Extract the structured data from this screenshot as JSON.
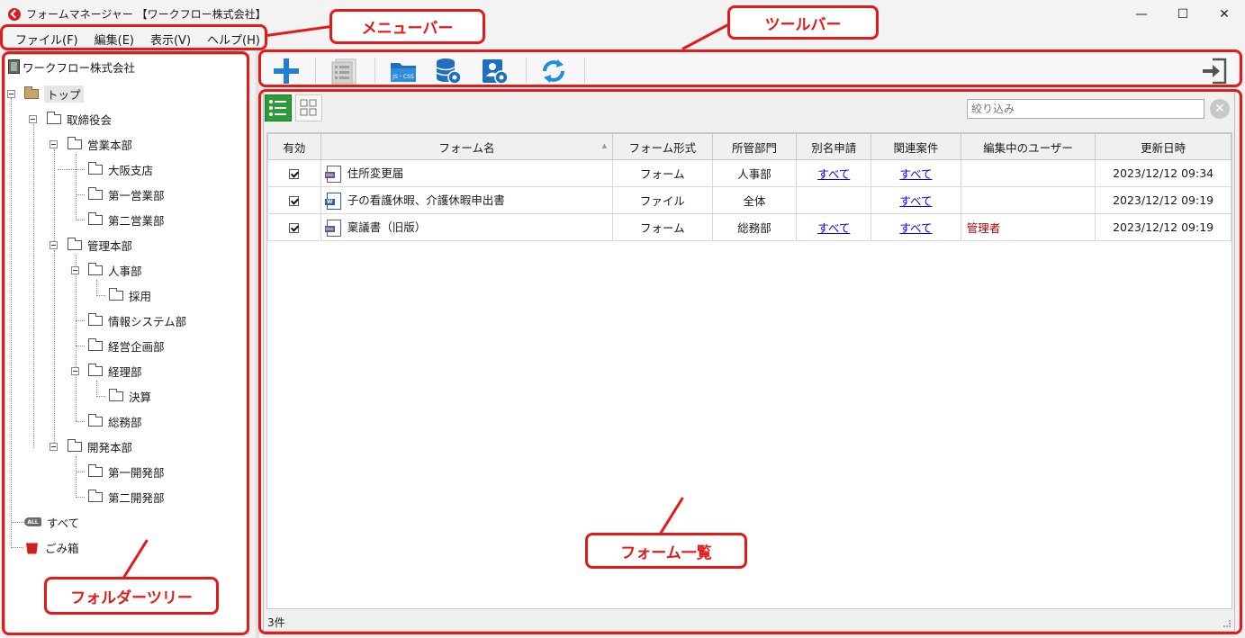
{
  "window": {
    "title": "フォームマネージャー 【ワークフロー株式会社】",
    "minimize_glyph": "—",
    "maximize_glyph": "☐",
    "close_glyph": "✕"
  },
  "menu": [
    {
      "label": "ファイル(F)"
    },
    {
      "label": "編集(E)"
    },
    {
      "label": "表示(V)"
    },
    {
      "label": "ヘルプ(H)"
    }
  ],
  "tree": {
    "root": "ワークフロー株式会社",
    "top": "トップ",
    "board": "取締役会",
    "sales_hq": "営業本部",
    "osaka": "大阪支店",
    "sales1": "第一営業部",
    "sales2": "第二営業部",
    "admin_hq": "管理本部",
    "hr": "人事部",
    "recruit": "採用",
    "it": "情報システム部",
    "planning": "経営企画部",
    "accounting": "経理部",
    "settlement": "決算",
    "general": "総務部",
    "dev_hq": "開発本部",
    "dev1": "第一開発部",
    "dev2": "第二開発部",
    "all": "すべて",
    "all_icon_text": "ALL",
    "trash": "ごみ箱"
  },
  "toolbar": {
    "icons": [
      "add-icon",
      "list-icon",
      "js-css-folder-icon",
      "database-settings-icon",
      "user-settings-icon",
      "refresh-icon",
      "exit-icon"
    ],
    "js_css_text": "JS・CSS"
  },
  "filter": {
    "placeholder": "絞り込み"
  },
  "table": {
    "headers": [
      "有効",
      "フォーム名",
      "フォーム形式",
      "所管部門",
      "別名申請",
      "関連案件",
      "編集中のユーザー",
      "更新日時"
    ],
    "rows": [
      {
        "enabled": true,
        "icon": "web-form-icon",
        "icon_text": "Web",
        "name": "住所変更届",
        "type": "フォーム",
        "dept": "人事部",
        "alias": "すべて",
        "related": "すべて",
        "editing_user": "",
        "updated": "2023/12/12 09:34"
      },
      {
        "enabled": true,
        "icon": "word-file-icon",
        "icon_text": "W",
        "name": "子の看護休暇、介護休暇申出書",
        "type": "ファイル",
        "dept": "全体",
        "alias": "",
        "related": "すべて",
        "editing_user": "",
        "updated": "2023/12/12 09:19"
      },
      {
        "enabled": true,
        "icon": "web-form-icon",
        "icon_text": "Web",
        "name": "稟議書（旧版）",
        "type": "フォーム",
        "dept": "総務部",
        "alias": "すべて",
        "related": "すべて",
        "editing_user": "管理者",
        "updated": "2023/12/12 09:19"
      }
    ]
  },
  "status": {
    "count": "3件"
  },
  "annotations": {
    "menubar": "メニューバー",
    "toolbar": "ツールバー",
    "form_list": "フォーム一覧",
    "folder_tree": "フォルダーツリー",
    "color": "#e21a1a"
  }
}
